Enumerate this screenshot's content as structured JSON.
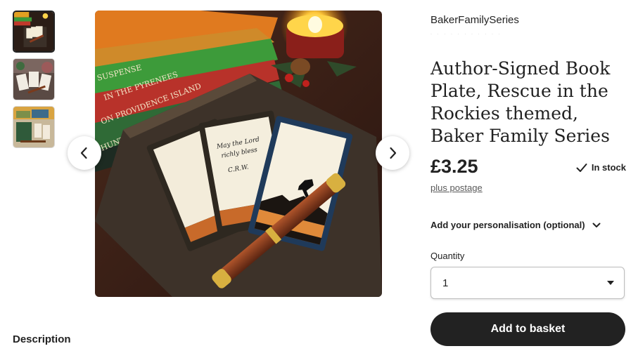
{
  "colors": {
    "text": "#222222",
    "muted": "#595959",
    "button_bg": "#222222",
    "button_text": "#ffffff",
    "border": "#bdbdbd"
  },
  "gallery": {
    "thumbnails": [
      "thumbnail-1",
      "thumbnail-2",
      "thumbnail-3"
    ],
    "selected_index": 0,
    "prev_icon": "chevron-left-icon",
    "next_icon": "chevron-right-icon",
    "book_spines": [
      "SUSPENSE",
      "IN THE PYRENEES",
      "ON PROVIDENCE ISLAND",
      "HUNTING IN THE HIGHLANDS"
    ],
    "card_text": [
      "May the Lord",
      "richly bless",
      "C.R.W."
    ]
  },
  "product": {
    "shop_name": "BakerFamilySeries",
    "title": "Author-Signed Book Plate, Rescue in the Rockies themed, Baker Family Series",
    "price": "£3.25",
    "stock_status": "In stock",
    "stock_icon": "checkmark-icon",
    "postage_link": "plus postage",
    "personalisation_label": "Add your personalisation (optional)",
    "personalisation_icon": "chevron-down-icon",
    "quantity_label": "Quantity",
    "quantity_value": "1",
    "quantity_icon": "caret-down-icon",
    "add_to_basket": "Add to basket"
  },
  "description": {
    "heading": "Description"
  }
}
